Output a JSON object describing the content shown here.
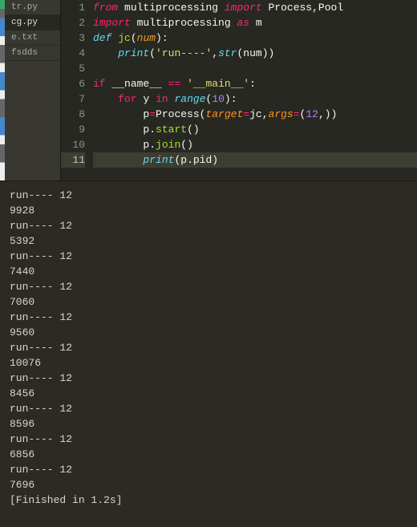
{
  "sidebar": {
    "tabs": [
      {
        "label": "tr.py",
        "active": false
      },
      {
        "label": "cg.py",
        "active": true
      },
      {
        "label": "e.txt",
        "active": false
      },
      {
        "label": "fsdds",
        "active": false
      }
    ]
  },
  "editor": {
    "highlighted_line": 11,
    "lines": [
      {
        "n": 1,
        "tokens": [
          {
            "t": "from",
            "c": "kw"
          },
          {
            "t": " ",
            "c": "id"
          },
          {
            "t": "multiprocessing",
            "c": "id"
          },
          {
            "t": " ",
            "c": "id"
          },
          {
            "t": "import",
            "c": "kw"
          },
          {
            "t": " ",
            "c": "id"
          },
          {
            "t": "Process",
            "c": "id"
          },
          {
            "t": ",",
            "c": "punc"
          },
          {
            "t": "Pool",
            "c": "id"
          }
        ]
      },
      {
        "n": 2,
        "tokens": [
          {
            "t": "import",
            "c": "kw"
          },
          {
            "t": " ",
            "c": "id"
          },
          {
            "t": "multiprocessing",
            "c": "id"
          },
          {
            "t": " ",
            "c": "id"
          },
          {
            "t": "as",
            "c": "kw"
          },
          {
            "t": " ",
            "c": "id"
          },
          {
            "t": "m",
            "c": "id"
          }
        ]
      },
      {
        "n": 3,
        "tokens": [
          {
            "t": "def",
            "c": "kw2"
          },
          {
            "t": " ",
            "c": "id"
          },
          {
            "t": "jc",
            "c": "fn"
          },
          {
            "t": "(",
            "c": "punc"
          },
          {
            "t": "num",
            "c": "arg"
          },
          {
            "t": "):",
            "c": "punc"
          }
        ]
      },
      {
        "n": 4,
        "tokens": [
          {
            "t": "    ",
            "c": "id"
          },
          {
            "t": "print",
            "c": "builtin"
          },
          {
            "t": "(",
            "c": "punc"
          },
          {
            "t": "'run----'",
            "c": "str"
          },
          {
            "t": ",",
            "c": "punc"
          },
          {
            "t": "str",
            "c": "builtin"
          },
          {
            "t": "(",
            "c": "punc"
          },
          {
            "t": "num",
            "c": "id"
          },
          {
            "t": "))",
            "c": "punc"
          }
        ]
      },
      {
        "n": 5,
        "tokens": []
      },
      {
        "n": 6,
        "tokens": [
          {
            "t": "if",
            "c": "kw3"
          },
          {
            "t": " ",
            "c": "id"
          },
          {
            "t": "__name__",
            "c": "id"
          },
          {
            "t": " ",
            "c": "id"
          },
          {
            "t": "==",
            "c": "op"
          },
          {
            "t": " ",
            "c": "id"
          },
          {
            "t": "'__main__'",
            "c": "str"
          },
          {
            "t": ":",
            "c": "punc"
          }
        ]
      },
      {
        "n": 7,
        "tokens": [
          {
            "t": "    ",
            "c": "id"
          },
          {
            "t": "for",
            "c": "kw3"
          },
          {
            "t": " ",
            "c": "id"
          },
          {
            "t": "y",
            "c": "id"
          },
          {
            "t": " ",
            "c": "id"
          },
          {
            "t": "in",
            "c": "kw3"
          },
          {
            "t": " ",
            "c": "id"
          },
          {
            "t": "range",
            "c": "builtin"
          },
          {
            "t": "(",
            "c": "punc"
          },
          {
            "t": "10",
            "c": "num"
          },
          {
            "t": "):",
            "c": "punc"
          }
        ]
      },
      {
        "n": 8,
        "tokens": [
          {
            "t": "        ",
            "c": "id"
          },
          {
            "t": "p",
            "c": "id"
          },
          {
            "t": "=",
            "c": "op"
          },
          {
            "t": "Process",
            "c": "id"
          },
          {
            "t": "(",
            "c": "punc"
          },
          {
            "t": "target",
            "c": "arg"
          },
          {
            "t": "=",
            "c": "op"
          },
          {
            "t": "jc",
            "c": "id"
          },
          {
            "t": ",",
            "c": "punc"
          },
          {
            "t": "args",
            "c": "arg"
          },
          {
            "t": "=",
            "c": "op"
          },
          {
            "t": "(",
            "c": "punc"
          },
          {
            "t": "12",
            "c": "num"
          },
          {
            "t": ",))",
            "c": "punc"
          }
        ]
      },
      {
        "n": 9,
        "tokens": [
          {
            "t": "        ",
            "c": "id"
          },
          {
            "t": "p",
            "c": "id"
          },
          {
            "t": ".",
            "c": "punc"
          },
          {
            "t": "start",
            "c": "fn"
          },
          {
            "t": "()",
            "c": "punc"
          }
        ]
      },
      {
        "n": 10,
        "tokens": [
          {
            "t": "        ",
            "c": "id"
          },
          {
            "t": "p",
            "c": "id"
          },
          {
            "t": ".",
            "c": "punc"
          },
          {
            "t": "join",
            "c": "fn"
          },
          {
            "t": "()",
            "c": "punc"
          }
        ]
      },
      {
        "n": 11,
        "tokens": [
          {
            "t": "        ",
            "c": "id"
          },
          {
            "t": "print",
            "c": "builtin"
          },
          {
            "t": "(",
            "c": "punc"
          },
          {
            "t": "p",
            "c": "id"
          },
          {
            "t": ".",
            "c": "punc"
          },
          {
            "t": "pid",
            "c": "id"
          },
          {
            "t": ")",
            "c": "punc"
          }
        ]
      }
    ]
  },
  "terminal": {
    "lines": [
      "run---- 12",
      "9928",
      "run---- 12",
      "5392",
      "run---- 12",
      "7440",
      "run---- 12",
      "7060",
      "run---- 12",
      "9560",
      "run---- 12",
      "10076",
      "run---- 12",
      "8456",
      "run---- 12",
      "8596",
      "run---- 12",
      "6856",
      "run---- 12",
      "7696",
      "[Finished in 1.2s]"
    ]
  }
}
